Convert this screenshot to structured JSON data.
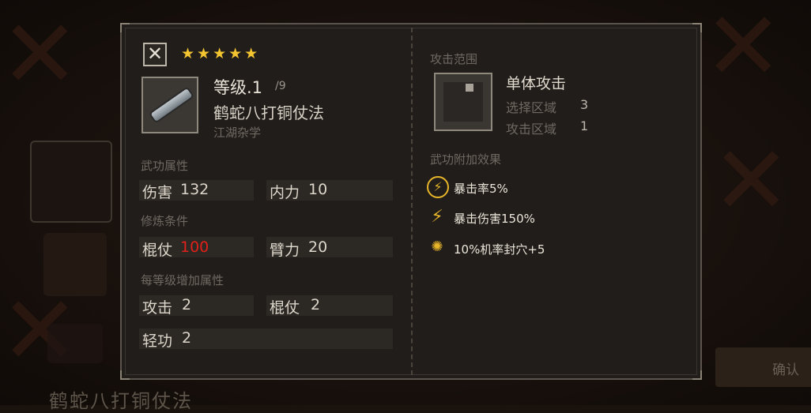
{
  "background": {
    "bottom_title": "鹤蛇八打铜仗法",
    "right_button_label": "确认"
  },
  "header": {
    "close_icon": "close-icon",
    "stars": "★★★★★",
    "star_count": 5
  },
  "skill": {
    "level_label": "等级.1",
    "level_max": "/9",
    "name": "鹤蛇八打铜仗法",
    "category": "江湖杂学"
  },
  "attributes": {
    "section_title": "武功属性",
    "damage_label": "伤害",
    "damage_value": "132",
    "neili_label": "内力",
    "neili_value": "10"
  },
  "requirements": {
    "section_title": "修炼条件",
    "staff_label": "棍仗",
    "staff_value": "100",
    "arm_label": "臂力",
    "arm_value": "20"
  },
  "per_level": {
    "section_title": "每等级增加属性",
    "attack_label": "攻击",
    "attack_value": "2",
    "staff_label": "棍仗",
    "staff_value": "2",
    "qinggong_label": "轻功",
    "qinggong_value": "2"
  },
  "range": {
    "section_title": "攻击范围",
    "type": "单体攻击",
    "select_label": "选择区域",
    "select_value": "3",
    "attack_area_label": "攻击区域",
    "attack_area_value": "1"
  },
  "effects": {
    "section_title": "武功附加效果",
    "items": [
      {
        "icon": "lightning-circle-icon",
        "text": "暴击率5%"
      },
      {
        "icon": "lightning-icon",
        "text": "暴击伤害150%"
      },
      {
        "icon": "seal-point-icon",
        "text": "10%机率封穴+5"
      }
    ]
  },
  "colors": {
    "star": "#f3c531",
    "warning": "#e0201a",
    "effect_icon": "#e7b52a"
  }
}
